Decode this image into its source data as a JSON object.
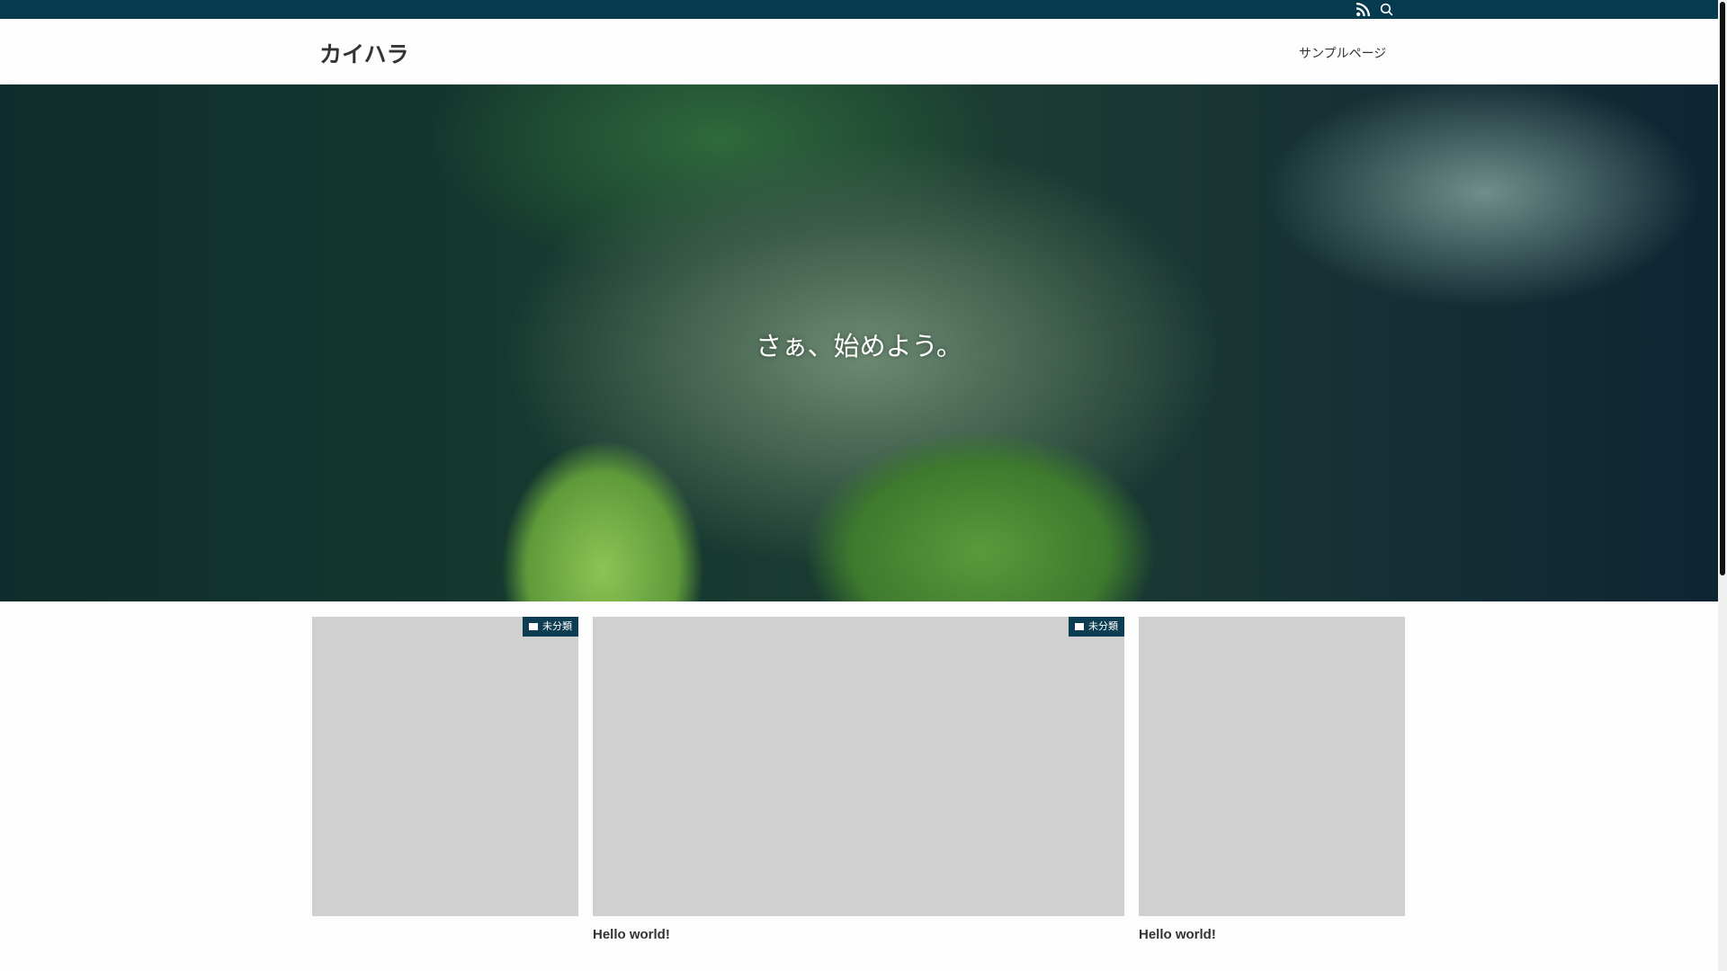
{
  "topbar": {
    "icons": [
      "rss-icon",
      "search-icon"
    ]
  },
  "header": {
    "logo": "カイハラ",
    "nav": [
      "サンプルページ"
    ]
  },
  "hero": {
    "text": "さぁ、始めよう。"
  },
  "cards": [
    {
      "category": "未分類",
      "title": ""
    },
    {
      "category": "未分類",
      "title": "Hello world!"
    },
    {
      "category": "",
      "title": "Hello world!"
    }
  ],
  "colors": {
    "accent": "#063a4f",
    "placeholder": "#d0d0d0"
  }
}
